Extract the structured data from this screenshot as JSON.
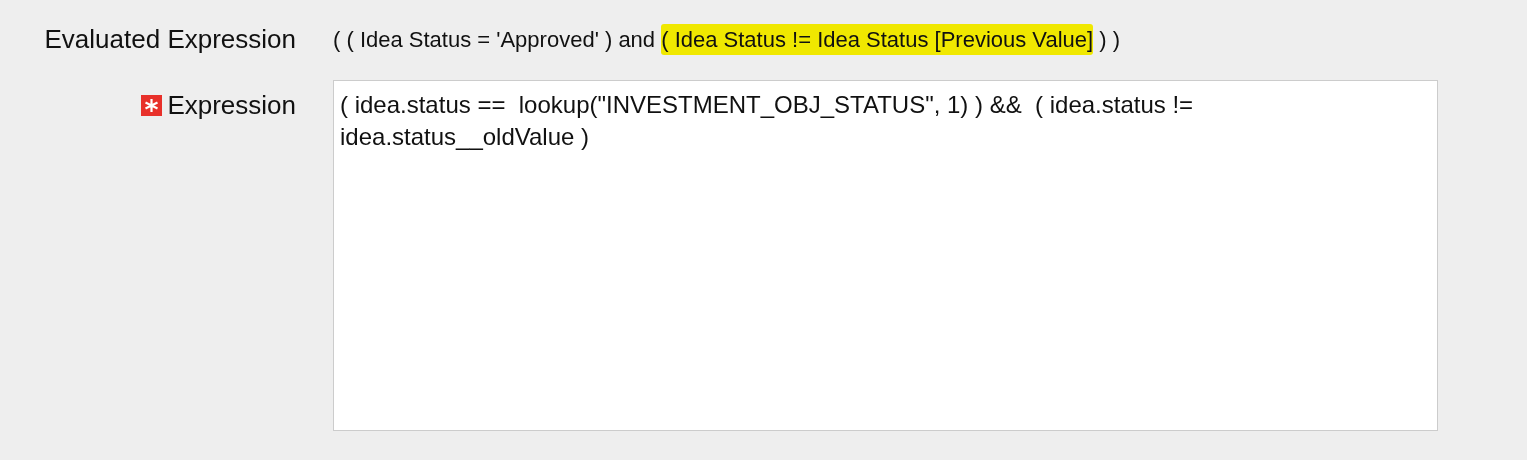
{
  "evaluated_expression": {
    "label": "Evaluated Expression",
    "parts": [
      {
        "text": "( ( Idea Status = 'Approved' ) and ",
        "highlighted": false
      },
      {
        "text": "( Idea Status != Idea Status [Previous Value]",
        "highlighted": true
      },
      {
        "text": " ) )",
        "highlighted": false
      }
    ]
  },
  "expression": {
    "label": "Expression",
    "required": true,
    "value": "( idea.status ==  lookup(\"INVESTMENT_OBJ_STATUS\", 1) ) &&  ( idea.status != idea.status__oldValue )"
  }
}
